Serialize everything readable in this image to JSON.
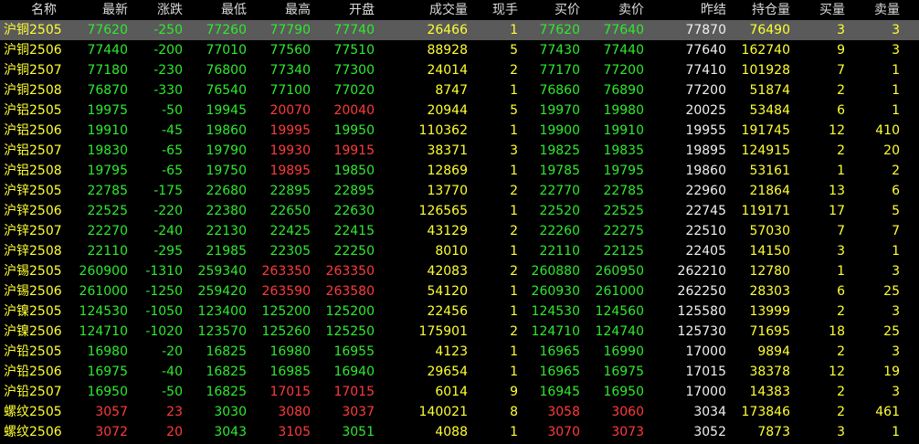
{
  "headers": [
    "名称",
    "最新",
    "涨跌",
    "最低",
    "最高",
    "开盘",
    "成交量",
    "现手",
    "买价",
    "卖价",
    "昨结",
    "持仓量",
    "买量",
    "卖量"
  ],
  "rows": [
    {
      "name": "沪铜2505",
      "latest": "77620",
      "change": "-250",
      "low": "77260",
      "high": "77790",
      "open": "77740",
      "volume": "26466",
      "hand": "1",
      "bid": "77620",
      "ask": "77640",
      "prev": "77870",
      "oi": "76490",
      "bq": "3",
      "aq": "3"
    },
    {
      "name": "沪铜2506",
      "latest": "77440",
      "change": "-200",
      "low": "77010",
      "high": "77560",
      "open": "77510",
      "volume": "88928",
      "hand": "5",
      "bid": "77430",
      "ask": "77440",
      "prev": "77640",
      "oi": "162740",
      "bq": "9",
      "aq": "3"
    },
    {
      "name": "沪铜2507",
      "latest": "77180",
      "change": "-230",
      "low": "76800",
      "high": "77340",
      "open": "77300",
      "volume": "24014",
      "hand": "2",
      "bid": "77170",
      "ask": "77200",
      "prev": "77410",
      "oi": "101928",
      "bq": "7",
      "aq": "1"
    },
    {
      "name": "沪铜2508",
      "latest": "76870",
      "change": "-330",
      "low": "76540",
      "high": "77100",
      "open": "77020",
      "volume": "8747",
      "hand": "1",
      "bid": "76860",
      "ask": "76890",
      "prev": "77200",
      "oi": "51874",
      "bq": "2",
      "aq": "1"
    },
    {
      "name": "沪铝2505",
      "latest": "19975",
      "change": "-50",
      "low": "19945",
      "high": "20070",
      "open": "20040",
      "volume": "20944",
      "hand": "5",
      "bid": "19970",
      "ask": "19980",
      "prev": "20025",
      "oi": "53484",
      "bq": "6",
      "aq": "1"
    },
    {
      "name": "沪铝2506",
      "latest": "19910",
      "change": "-45",
      "low": "19860",
      "high": "19995",
      "open": "19950",
      "volume": "110362",
      "hand": "1",
      "bid": "19900",
      "ask": "19910",
      "prev": "19955",
      "oi": "191745",
      "bq": "12",
      "aq": "410"
    },
    {
      "name": "沪铝2507",
      "latest": "19830",
      "change": "-65",
      "low": "19790",
      "high": "19930",
      "open": "19915",
      "volume": "38371",
      "hand": "3",
      "bid": "19825",
      "ask": "19835",
      "prev": "19895",
      "oi": "124915",
      "bq": "2",
      "aq": "20"
    },
    {
      "name": "沪铝2508",
      "latest": "19795",
      "change": "-65",
      "low": "19750",
      "high": "19895",
      "open": "19850",
      "volume": "12869",
      "hand": "1",
      "bid": "19785",
      "ask": "19795",
      "prev": "19860",
      "oi": "53161",
      "bq": "1",
      "aq": "2"
    },
    {
      "name": "沪锌2505",
      "latest": "22785",
      "change": "-175",
      "low": "22680",
      "high": "22895",
      "open": "22895",
      "volume": "13770",
      "hand": "2",
      "bid": "22770",
      "ask": "22785",
      "prev": "22960",
      "oi": "21864",
      "bq": "13",
      "aq": "6"
    },
    {
      "name": "沪锌2506",
      "latest": "22525",
      "change": "-220",
      "low": "22380",
      "high": "22650",
      "open": "22630",
      "volume": "126565",
      "hand": "1",
      "bid": "22520",
      "ask": "22525",
      "prev": "22745",
      "oi": "119171",
      "bq": "17",
      "aq": "5"
    },
    {
      "name": "沪锌2507",
      "latest": "22270",
      "change": "-240",
      "low": "22130",
      "high": "22425",
      "open": "22415",
      "volume": "43129",
      "hand": "2",
      "bid": "22260",
      "ask": "22275",
      "prev": "22510",
      "oi": "57030",
      "bq": "7",
      "aq": "7"
    },
    {
      "name": "沪锌2508",
      "latest": "22110",
      "change": "-295",
      "low": "21985",
      "high": "22305",
      "open": "22250",
      "volume": "8010",
      "hand": "1",
      "bid": "22110",
      "ask": "22125",
      "prev": "22405",
      "oi": "14150",
      "bq": "3",
      "aq": "1"
    },
    {
      "name": "沪锡2505",
      "latest": "260900",
      "change": "-1310",
      "low": "259340",
      "high": "263350",
      "open": "263350",
      "volume": "42083",
      "hand": "2",
      "bid": "260880",
      "ask": "260950",
      "prev": "262210",
      "oi": "12780",
      "bq": "1",
      "aq": "3"
    },
    {
      "name": "沪锡2506",
      "latest": "261000",
      "change": "-1250",
      "low": "259420",
      "high": "263590",
      "open": "263580",
      "volume": "54120",
      "hand": "1",
      "bid": "260930",
      "ask": "261000",
      "prev": "262250",
      "oi": "28303",
      "bq": "6",
      "aq": "25"
    },
    {
      "name": "沪镍2505",
      "latest": "124530",
      "change": "-1050",
      "low": "123400",
      "high": "125200",
      "open": "125200",
      "volume": "22456",
      "hand": "1",
      "bid": "124530",
      "ask": "124560",
      "prev": "125580",
      "oi": "13999",
      "bq": "2",
      "aq": "3"
    },
    {
      "name": "沪镍2506",
      "latest": "124710",
      "change": "-1020",
      "low": "123570",
      "high": "125260",
      "open": "125250",
      "volume": "175901",
      "hand": "2",
      "bid": "124710",
      "ask": "124740",
      "prev": "125730",
      "oi": "71695",
      "bq": "18",
      "aq": "25"
    },
    {
      "name": "沪铅2505",
      "latest": "16980",
      "change": "-20",
      "low": "16825",
      "high": "16980",
      "open": "16955",
      "volume": "4123",
      "hand": "1",
      "bid": "16965",
      "ask": "16990",
      "prev": "17000",
      "oi": "9894",
      "bq": "2",
      "aq": "3"
    },
    {
      "name": "沪铅2506",
      "latest": "16975",
      "change": "-40",
      "low": "16825",
      "high": "16985",
      "open": "16940",
      "volume": "29654",
      "hand": "1",
      "bid": "16965",
      "ask": "16975",
      "prev": "17015",
      "oi": "38378",
      "bq": "12",
      "aq": "19"
    },
    {
      "name": "沪铅2507",
      "latest": "16950",
      "change": "-50",
      "low": "16825",
      "high": "17015",
      "open": "17015",
      "volume": "6014",
      "hand": "9",
      "bid": "16945",
      "ask": "16950",
      "prev": "17000",
      "oi": "14383",
      "bq": "2",
      "aq": "3"
    },
    {
      "name": "螺纹2505",
      "latest": "3057",
      "change": "23",
      "low": "3030",
      "high": "3080",
      "open": "3037",
      "volume": "140021",
      "hand": "8",
      "bid": "3058",
      "ask": "3060",
      "prev": "3034",
      "oi": "173846",
      "bq": "2",
      "aq": "461"
    },
    {
      "name": "螺纹2506",
      "latest": "3072",
      "change": "20",
      "low": "3043",
      "high": "3105",
      "open": "3051",
      "volume": "4088",
      "hand": "1",
      "bid": "3070",
      "ask": "3073",
      "prev": "3052",
      "oi": "7873",
      "bq": "3",
      "aq": "1"
    }
  ],
  "colors": {
    "up": "#ff3b3b",
    "down": "#2eea2e",
    "neutral": "#f0f0f0",
    "highlight": "#ffff33",
    "selected_row_bg": "#5a5a5a"
  }
}
